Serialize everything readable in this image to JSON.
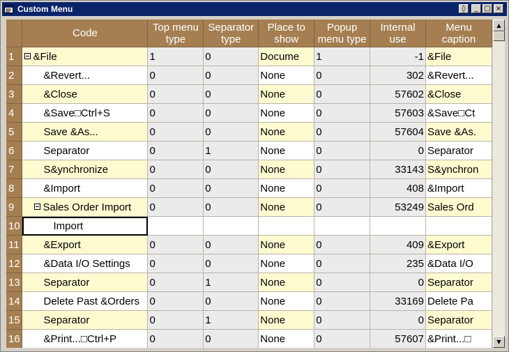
{
  "window": {
    "title": "Custom Menu",
    "buttons": [
      "restore-icon",
      "minimize-icon",
      "maximize-icon",
      "close-icon"
    ]
  },
  "grid": {
    "columns": [
      "Code",
      "Top menu type",
      "Separator type",
      "Place to show",
      "Popup menu type",
      "Internal use",
      "Menu caption"
    ],
    "rows": [
      {
        "num": "1",
        "code": "&File",
        "indent": 0,
        "expander": true,
        "top": "1",
        "sep": "0",
        "place": "Docume",
        "popup": "1",
        "internal": "-1",
        "caption": "&File",
        "style": "yellow"
      },
      {
        "num": "2",
        "code": "&Revert...",
        "indent": 1,
        "expander": false,
        "top": "0",
        "sep": "0",
        "place": "None",
        "popup": "0",
        "internal": "302",
        "caption": "&Revert...",
        "style": "white"
      },
      {
        "num": "3",
        "code": "&Close",
        "indent": 1,
        "expander": false,
        "top": "0",
        "sep": "0",
        "place": "None",
        "popup": "0",
        "internal": "57602",
        "caption": "&Close",
        "style": "yellow"
      },
      {
        "num": "4",
        "code": "&Save□Ctrl+S",
        "indent": 1,
        "expander": false,
        "top": "0",
        "sep": "0",
        "place": "None",
        "popup": "0",
        "internal": "57603",
        "caption": "&Save□Ct",
        "style": "white"
      },
      {
        "num": "5",
        "code": "Save &As...",
        "indent": 1,
        "expander": false,
        "top": "0",
        "sep": "0",
        "place": "None",
        "popup": "0",
        "internal": "57604",
        "caption": "Save &As.",
        "style": "yellow"
      },
      {
        "num": "6",
        "code": "Separator",
        "indent": 1,
        "expander": false,
        "top": "0",
        "sep": "1",
        "place": "None",
        "popup": "0",
        "internal": "0",
        "caption": "Separator",
        "style": "white"
      },
      {
        "num": "7",
        "code": "S&ynchronize",
        "indent": 1,
        "expander": false,
        "top": "0",
        "sep": "0",
        "place": "None",
        "popup": "0",
        "internal": "33143",
        "caption": "S&ynchron",
        "style": "yellow"
      },
      {
        "num": "8",
        "code": "&Import",
        "indent": 1,
        "expander": false,
        "top": "0",
        "sep": "0",
        "place": "None",
        "popup": "0",
        "internal": "408",
        "caption": "&Import",
        "style": "white"
      },
      {
        "num": "9",
        "code": "Sales Order Import",
        "indent": 1,
        "expander": true,
        "top": "0",
        "sep": "0",
        "place": "None",
        "popup": "0",
        "internal": "53249",
        "caption": "Sales Ord",
        "style": "yellow"
      },
      {
        "num": "10",
        "code": "Import",
        "indent": 2,
        "expander": false,
        "top": "",
        "sep": "",
        "place": "",
        "popup": "",
        "internal": "",
        "caption": "",
        "style": "editing"
      },
      {
        "num": "11",
        "code": "&Export",
        "indent": 1,
        "expander": false,
        "top": "0",
        "sep": "0",
        "place": "None",
        "popup": "0",
        "internal": "409",
        "caption": "&Export",
        "style": "yellow"
      },
      {
        "num": "12",
        "code": "&Data I/O Settings",
        "indent": 1,
        "expander": false,
        "top": "0",
        "sep": "0",
        "place": "None",
        "popup": "0",
        "internal": "235",
        "caption": "&Data I/O",
        "style": "white"
      },
      {
        "num": "13",
        "code": "Separator",
        "indent": 1,
        "expander": false,
        "top": "0",
        "sep": "1",
        "place": "None",
        "popup": "0",
        "internal": "0",
        "caption": "Separator",
        "style": "yellow"
      },
      {
        "num": "14",
        "code": "Delete Past &Orders",
        "indent": 1,
        "expander": false,
        "top": "0",
        "sep": "0",
        "place": "None",
        "popup": "0",
        "internal": "33169",
        "caption": "Delete Pa",
        "style": "white"
      },
      {
        "num": "15",
        "code": "Separator",
        "indent": 1,
        "expander": false,
        "top": "0",
        "sep": "1",
        "place": "None",
        "popup": "0",
        "internal": "0",
        "caption": "Separator",
        "style": "yellow"
      },
      {
        "num": "16",
        "code": "&Print...□Ctrl+P",
        "indent": 1,
        "expander": false,
        "top": "0",
        "sep": "0",
        "place": "None",
        "popup": "0",
        "internal": "57607",
        "caption": "&Print...□",
        "style": "white"
      }
    ]
  },
  "colors": {
    "header": "#a57f51",
    "row_yellow": "#fffbd1",
    "row_gray": "#ebebeb",
    "title_bar": "#0a246a"
  }
}
